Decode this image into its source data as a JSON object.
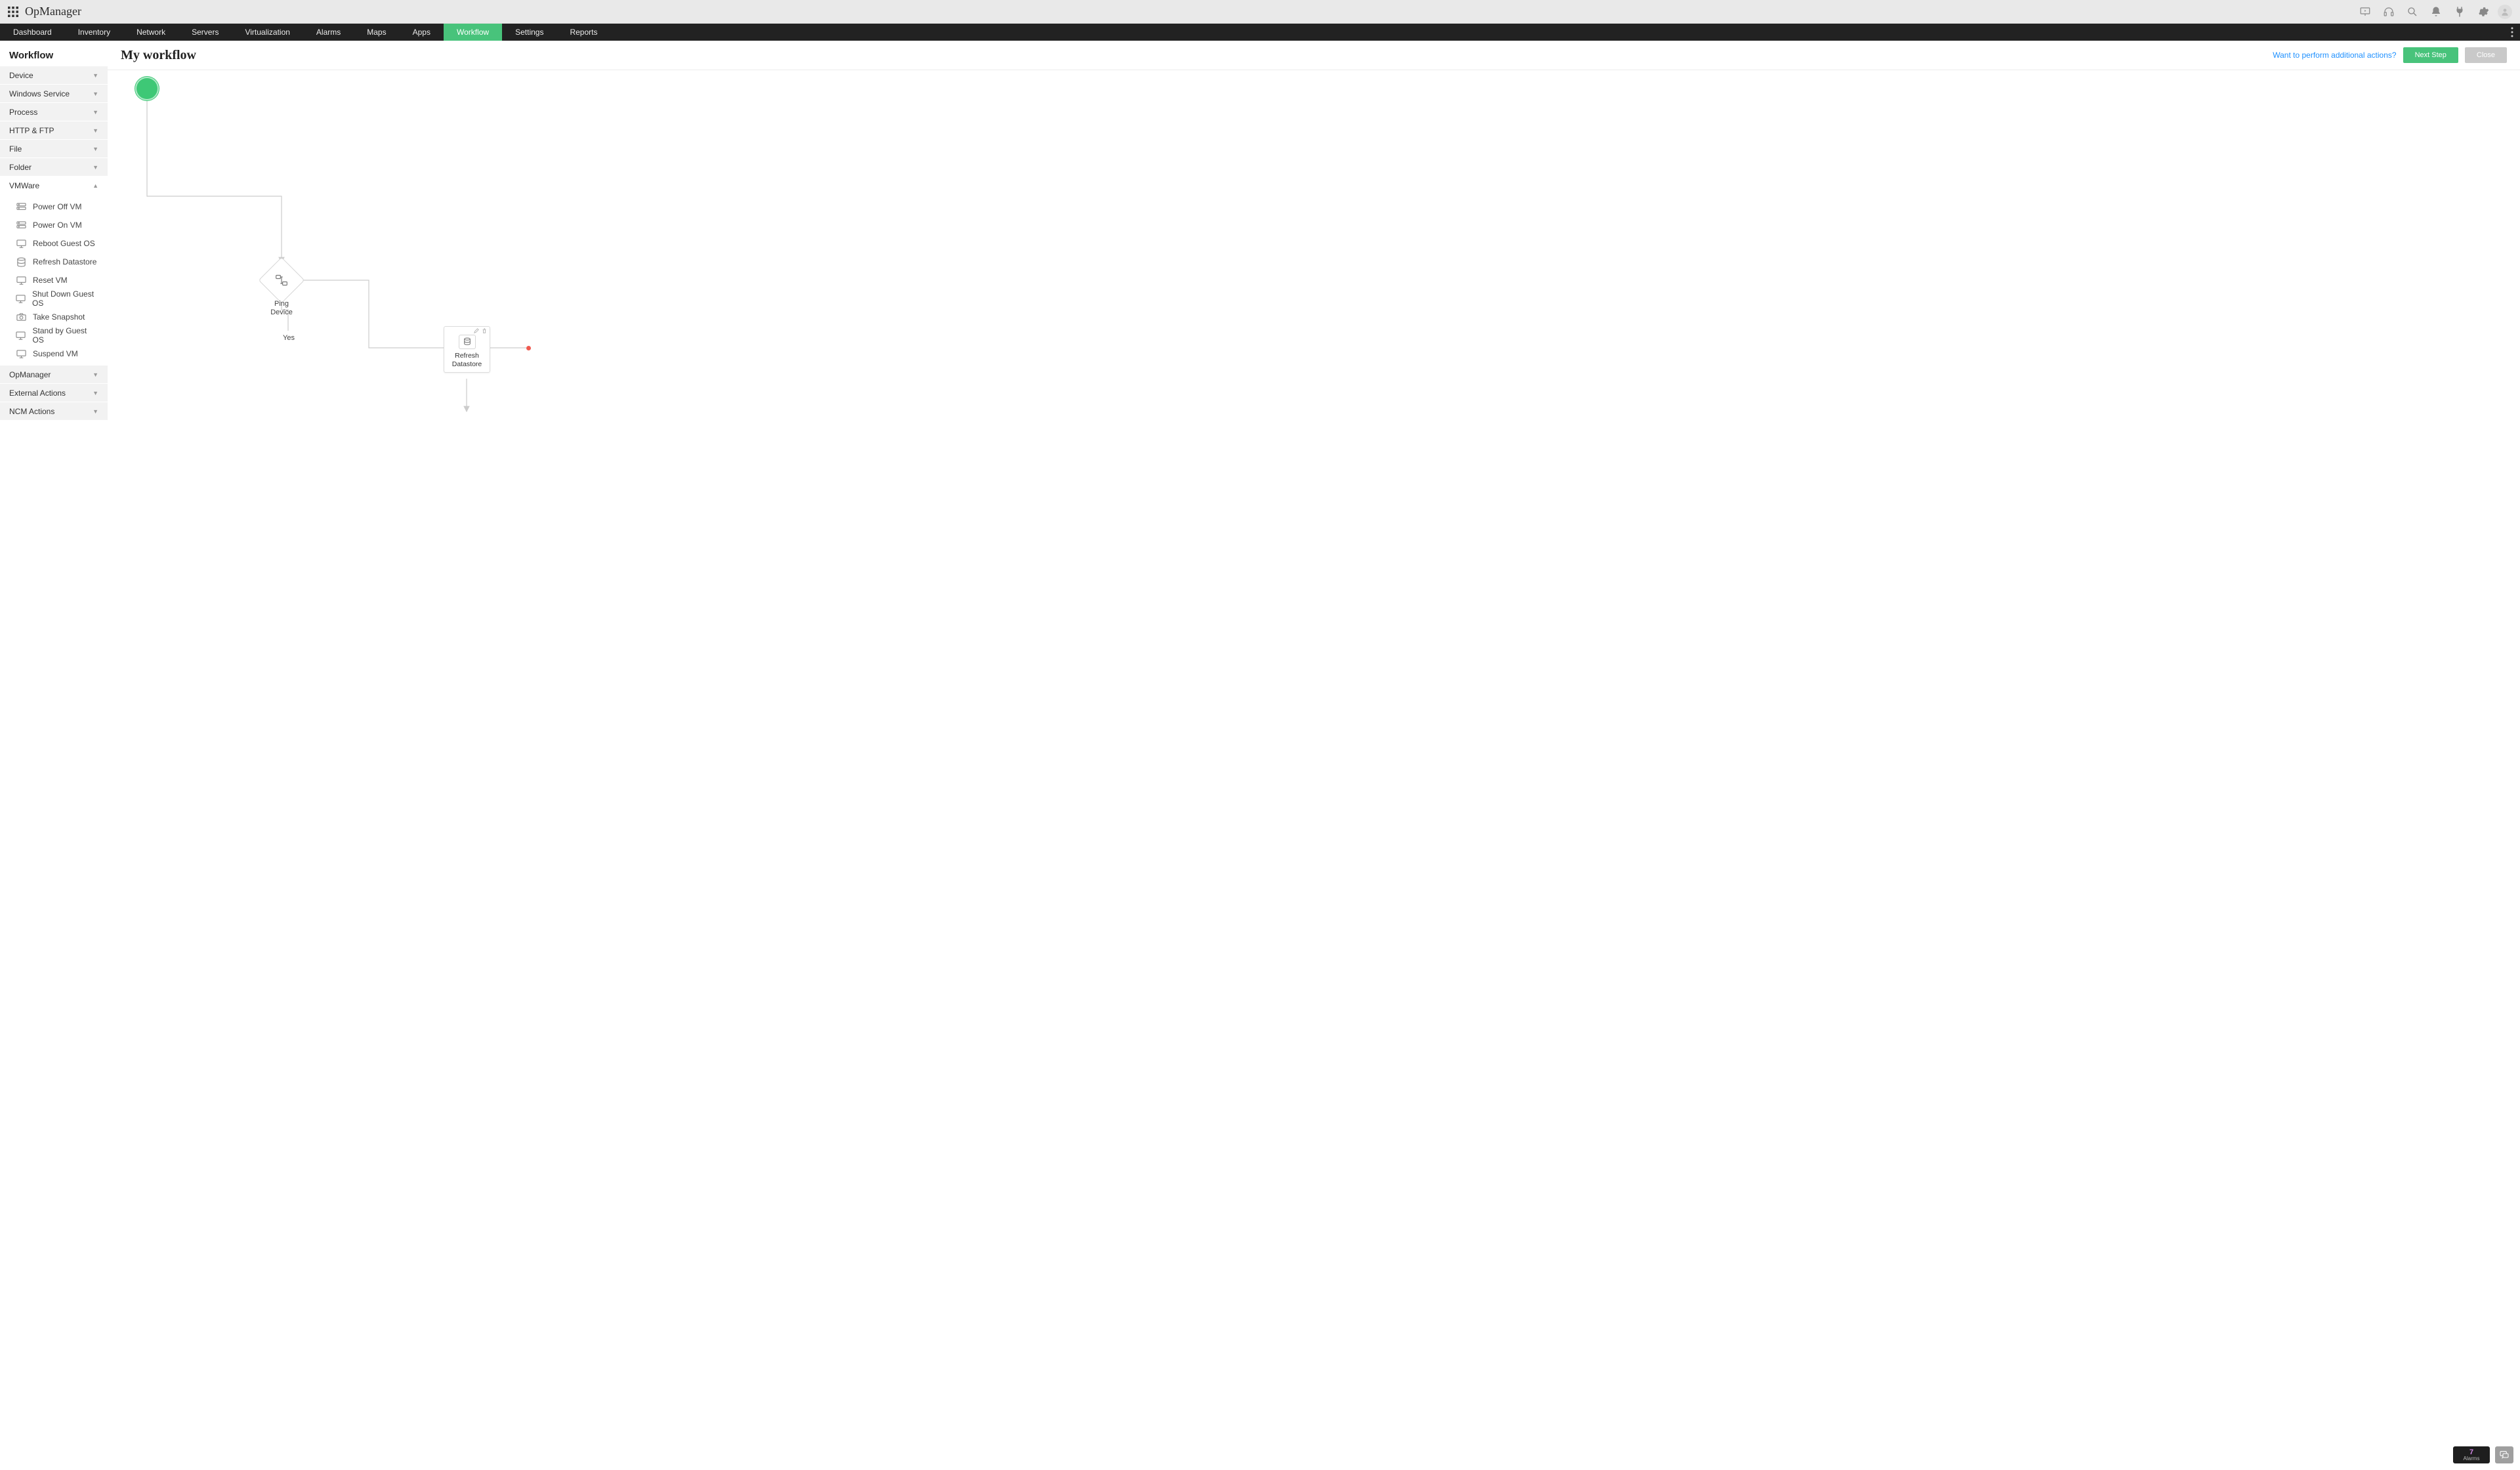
{
  "brand": "OpManager",
  "mainnav": {
    "items": [
      {
        "label": "Dashboard",
        "active": false
      },
      {
        "label": "Inventory",
        "active": false
      },
      {
        "label": "Network",
        "active": false
      },
      {
        "label": "Servers",
        "active": false
      },
      {
        "label": "Virtualization",
        "active": false
      },
      {
        "label": "Alarms",
        "active": false
      },
      {
        "label": "Maps",
        "active": false
      },
      {
        "label": "Apps",
        "active": false
      },
      {
        "label": "Workflow",
        "active": true
      },
      {
        "label": "Settings",
        "active": false
      },
      {
        "label": "Reports",
        "active": false
      }
    ]
  },
  "sidebar": {
    "title": "Workflow",
    "sections": [
      {
        "label": "Device",
        "open": false
      },
      {
        "label": "Windows Service",
        "open": false
      },
      {
        "label": "Process",
        "open": false
      },
      {
        "label": "HTTP & FTP",
        "open": false
      },
      {
        "label": "File",
        "open": false
      },
      {
        "label": "Folder",
        "open": false
      },
      {
        "label": "VMWare",
        "open": true,
        "items": [
          "Power Off VM",
          "Power On VM",
          "Reboot Guest OS",
          "Refresh Datastore",
          "Reset VM",
          "Shut Down Guest OS",
          "Take Snapshot",
          "Stand by Guest OS",
          "Suspend VM"
        ]
      },
      {
        "label": "OpManager",
        "open": false
      },
      {
        "label": "External Actions",
        "open": false
      },
      {
        "label": "NCM Actions",
        "open": false
      }
    ]
  },
  "canvas_header": {
    "title": "My workflow",
    "help_link": "Want to perform additional actions?",
    "next_button": "Next Step",
    "close_button": "Close"
  },
  "workflow": {
    "decision_label_line1": "Ping",
    "decision_label_line2": "Device",
    "decision_yes": "Yes",
    "action_label_line1": "Refresh",
    "action_label_line2": "Datastore"
  },
  "footer": {
    "alarm_count": "7",
    "alarm_label": "Alarms"
  }
}
